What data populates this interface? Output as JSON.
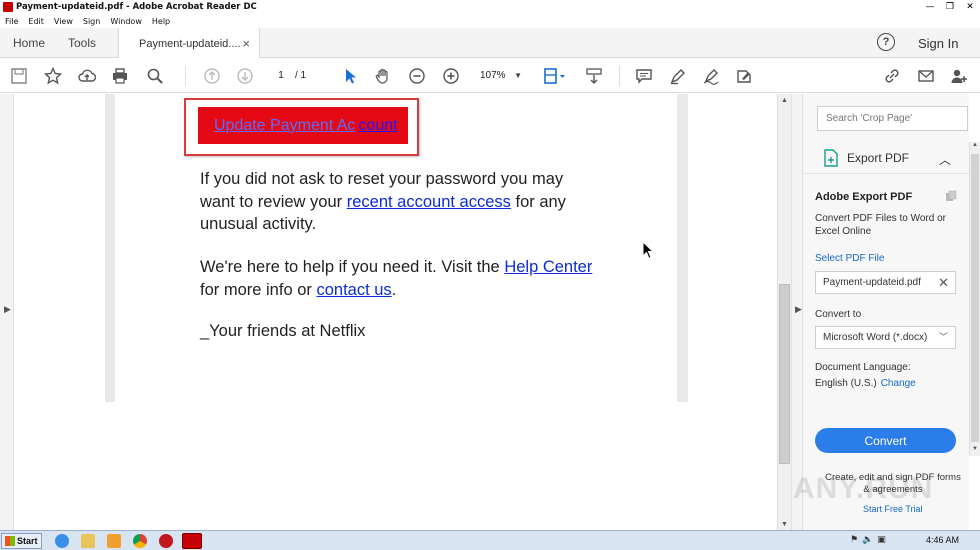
{
  "window": {
    "title": "Payment-updateid.pdf - Adobe Acrobat Reader DC",
    "controls": [
      "—",
      "❐",
      "✕"
    ]
  },
  "menu": [
    "File",
    "Edit",
    "View",
    "Sign",
    "Window",
    "Help"
  ],
  "tabs": {
    "home": "Home",
    "tools": "Tools",
    "document": "Payment-updateid....",
    "close": "×",
    "help": "?",
    "sign_in": "Sign In"
  },
  "toolbar": {
    "page_current": "1",
    "page_total": "/ 1",
    "zoom": "107%"
  },
  "document": {
    "button_part1": "Update Payment Ac",
    "button_part2": "count",
    "p1_text1": "If you did not ask to reset your password you may want to review your ",
    "p1_link": "recent account access",
    "p1_text2": " for any unusual activity.",
    "p2_text1": "We're here to help if you need it. Visit the ",
    "p2_link1": "Help Center",
    "p2_text2": " for more info or ",
    "p2_link2": "contact us",
    "p2_text3": ".",
    "p3_text": "_Your friends at Netflix"
  },
  "right_panel": {
    "search_placeholder": "Search 'Crop Page'",
    "export_header": "Export PDF",
    "title": "Adobe Export PDF",
    "description": "Convert PDF Files to Word or Excel Online",
    "select_label": "Select PDF File",
    "file_name": "Payment-updateid.pdf",
    "convert_to_label": "Convert to",
    "format": "Microsoft Word (*.docx)",
    "language_label": "Document Language:",
    "language_value": "English (U.S.)",
    "language_change": "Change",
    "convert_button": "Convert",
    "promo": "Create, edit and sign PDF forms & agreements",
    "trial_link": "Start Free Trial",
    "watermark": "ANY.RUN"
  },
  "taskbar": {
    "start": "Start",
    "clock": "4:46 AM"
  },
  "colors": {
    "accent_blue": "#2b7de9",
    "button_red": "#e50914",
    "link_blue": "#0b2bd8"
  }
}
